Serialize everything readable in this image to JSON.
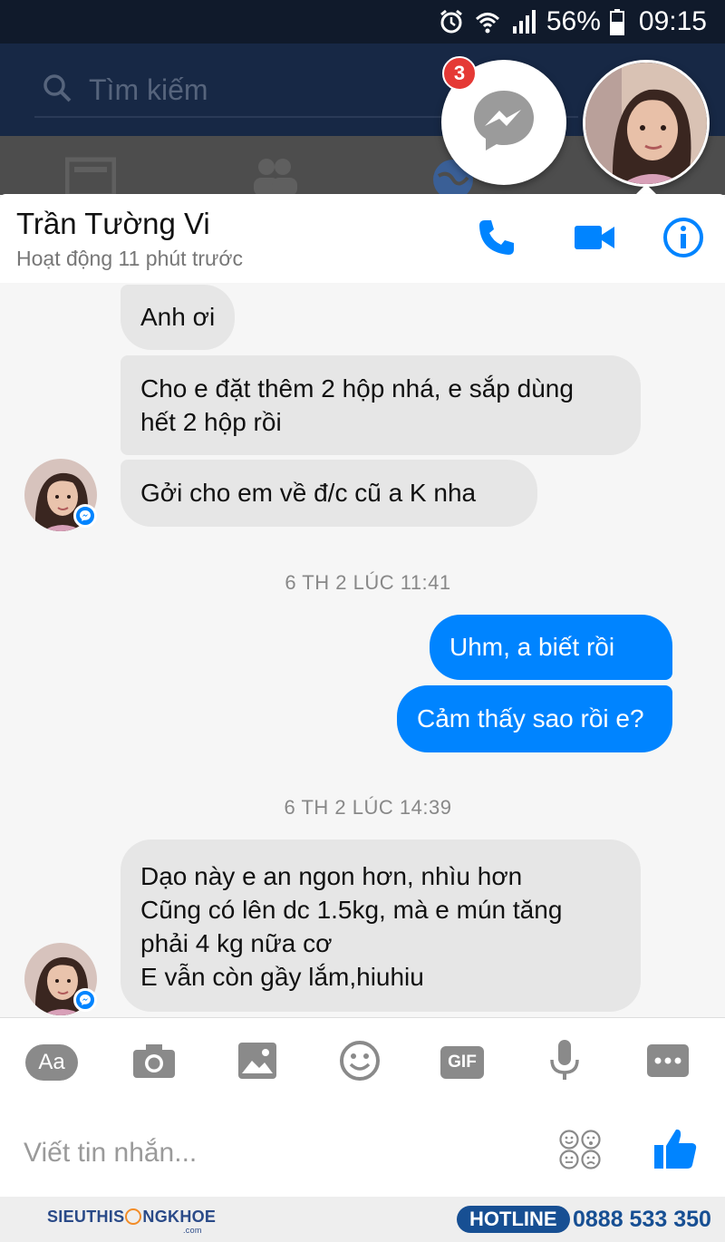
{
  "status_bar": {
    "battery": "56%",
    "time": "09:15"
  },
  "fb_header": {
    "search_placeholder": "Tìm kiếm"
  },
  "chat_head": {
    "unread_count": "3"
  },
  "conversation": {
    "name": "Trần Tường Vi",
    "status": "Hoạt động 11 phút trước"
  },
  "messages": {
    "m1": "Anh ơi",
    "m2": [
      "Cho e đặt thêm 2 hộp nhá, e sắp dùng",
      "hết 2 hộp rồi"
    ],
    "m3": "Gởi cho em về đ/c cũ a K nha",
    "ts1": "6 TH 2  LÚC 11:41",
    "m4": "Uhm, a biết rồi",
    "m5": "Cảm thấy sao rồi e?",
    "ts2": "6 TH 2  LÚC 14:39",
    "m6": [
      "Dạo này e an ngon hơn, nhìu hơn",
      "Cũng có lên dc 1.5kg, mà e mún tăng",
      "phải 4 kg nữa cơ",
      "E vẫn còn gầy lắm,hiuhiu"
    ]
  },
  "toolbar": {
    "aa_label": "Aa",
    "gif_label": "GIF"
  },
  "composer": {
    "placeholder": "Viết tin nhắn..."
  },
  "footer": {
    "logo_text": "SIEUTHISỨCKHỎE",
    "logo_prefix": "SIEUTHIS",
    "logo_suffix": "NGKHOE",
    "logo_domain": ".com",
    "hotline_label": "HOTLINE",
    "phone": "0888 533 350"
  },
  "colors": {
    "messenger_blue": "#0084ff",
    "incoming_bubble": "#e6e6e6",
    "header_navy": "#172845",
    "badge_red": "#e53935"
  },
  "icons": [
    "alarm-icon",
    "wifi-icon",
    "signal-icon",
    "battery-icon",
    "search-icon",
    "messenger-icon",
    "phone-icon",
    "video-icon",
    "info-icon",
    "camera-icon",
    "image-icon",
    "smiley-icon",
    "gif-icon",
    "mic-icon",
    "more-icon",
    "emoji-faces-icon",
    "thumbs-up-icon"
  ]
}
